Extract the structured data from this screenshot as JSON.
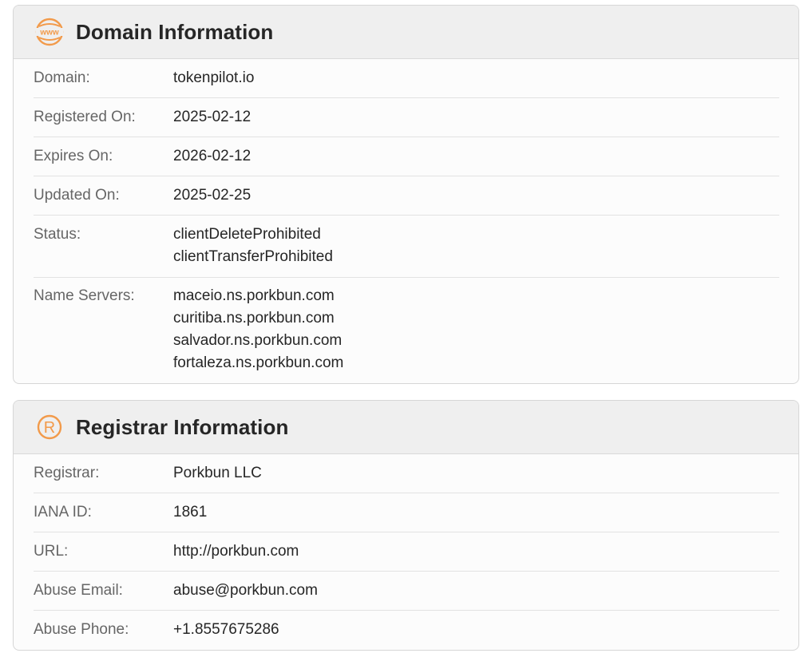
{
  "domain_info": {
    "title": "Domain Information",
    "icon": "www-icon",
    "accent_color": "#f29a4a",
    "rows": {
      "domain": {
        "label": "Domain:",
        "value": "tokenpilot.io"
      },
      "registered": {
        "label": "Registered On:",
        "value": "2025-02-12"
      },
      "expires": {
        "label": "Expires On:",
        "value": "2026-02-12"
      },
      "updated": {
        "label": "Updated On:",
        "value": "2025-02-25"
      },
      "status": {
        "label": "Status:",
        "values": [
          "clientDeleteProhibited",
          "clientTransferProhibited"
        ]
      },
      "name_servers": {
        "label": "Name Servers:",
        "values": [
          "maceio.ns.porkbun.com",
          "curitiba.ns.porkbun.com",
          "salvador.ns.porkbun.com",
          "fortaleza.ns.porkbun.com"
        ]
      }
    }
  },
  "registrar_info": {
    "title": "Registrar Information",
    "icon": "registered-trademark-icon",
    "accent_color": "#f29a4a",
    "rows": {
      "registrar": {
        "label": "Registrar:",
        "value": "Porkbun LLC"
      },
      "iana_id": {
        "label": "IANA ID:",
        "value": "1861"
      },
      "url": {
        "label": "URL:",
        "value": "http://porkbun.com"
      },
      "abuse_email": {
        "label": "Abuse Email:",
        "value": "abuse@porkbun.com"
      },
      "abuse_phone": {
        "label": "Abuse Phone:",
        "value": "+1.8557675286"
      }
    }
  }
}
